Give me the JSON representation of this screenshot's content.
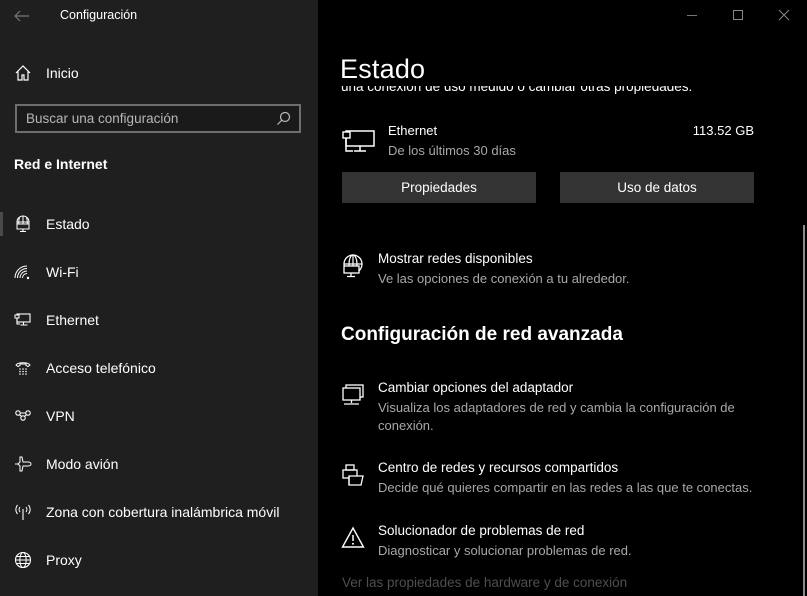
{
  "window": {
    "title": "Configuración",
    "controls": {
      "minimize": "minimize-icon",
      "maximize": "maximize-icon",
      "close": "close-icon"
    }
  },
  "sidebar": {
    "home_label": "Inicio",
    "search_placeholder": "Buscar una configuración",
    "search_value": "",
    "section_title": "Red e Internet",
    "items": [
      {
        "label": "Estado",
        "icon": "network-status-icon",
        "selected": true
      },
      {
        "label": "Wi-Fi",
        "icon": "wifi-icon",
        "selected": false
      },
      {
        "label": "Ethernet",
        "icon": "ethernet-icon",
        "selected": false
      },
      {
        "label": "Acceso telefónico",
        "icon": "dialup-phone-icon",
        "selected": false
      },
      {
        "label": "VPN",
        "icon": "vpn-icon",
        "selected": false
      },
      {
        "label": "Modo avión",
        "icon": "airplane-icon",
        "selected": false
      },
      {
        "label": "Zona con cobertura inalámbrica móvil",
        "icon": "mobile-hotspot-icon",
        "selected": false
      },
      {
        "label": "Proxy",
        "icon": "globe-icon",
        "selected": false
      }
    ]
  },
  "main": {
    "page_title": "Estado",
    "clipped_text": "una conexión de uso medido o cambiar otras propiedades.",
    "ethernet": {
      "name": "Ethernet",
      "subtitle": "De los últimos 30 días",
      "data_used": "113.52 GB"
    },
    "buttons": {
      "properties": "Propiedades",
      "data_usage": "Uso de datos"
    },
    "show_networks": {
      "title": "Mostrar redes disponibles",
      "desc": "Ve las opciones de conexión a tu alrededor."
    },
    "advanced_heading": "Configuración de red avanzada",
    "advanced_items": [
      {
        "title": "Cambiar opciones del adaptador",
        "desc": "Visualiza los adaptadores de red y cambia la configuración de conexión."
      },
      {
        "title": "Centro de redes y recursos compartidos",
        "desc": "Decide qué quieres compartir en las redes a las que te conectas."
      },
      {
        "title": "Solucionador de problemas de red",
        "desc": "Diagnosticar y solucionar problemas de red."
      }
    ],
    "hardware_link": "Ver las propiedades de hardware y de conexión"
  }
}
